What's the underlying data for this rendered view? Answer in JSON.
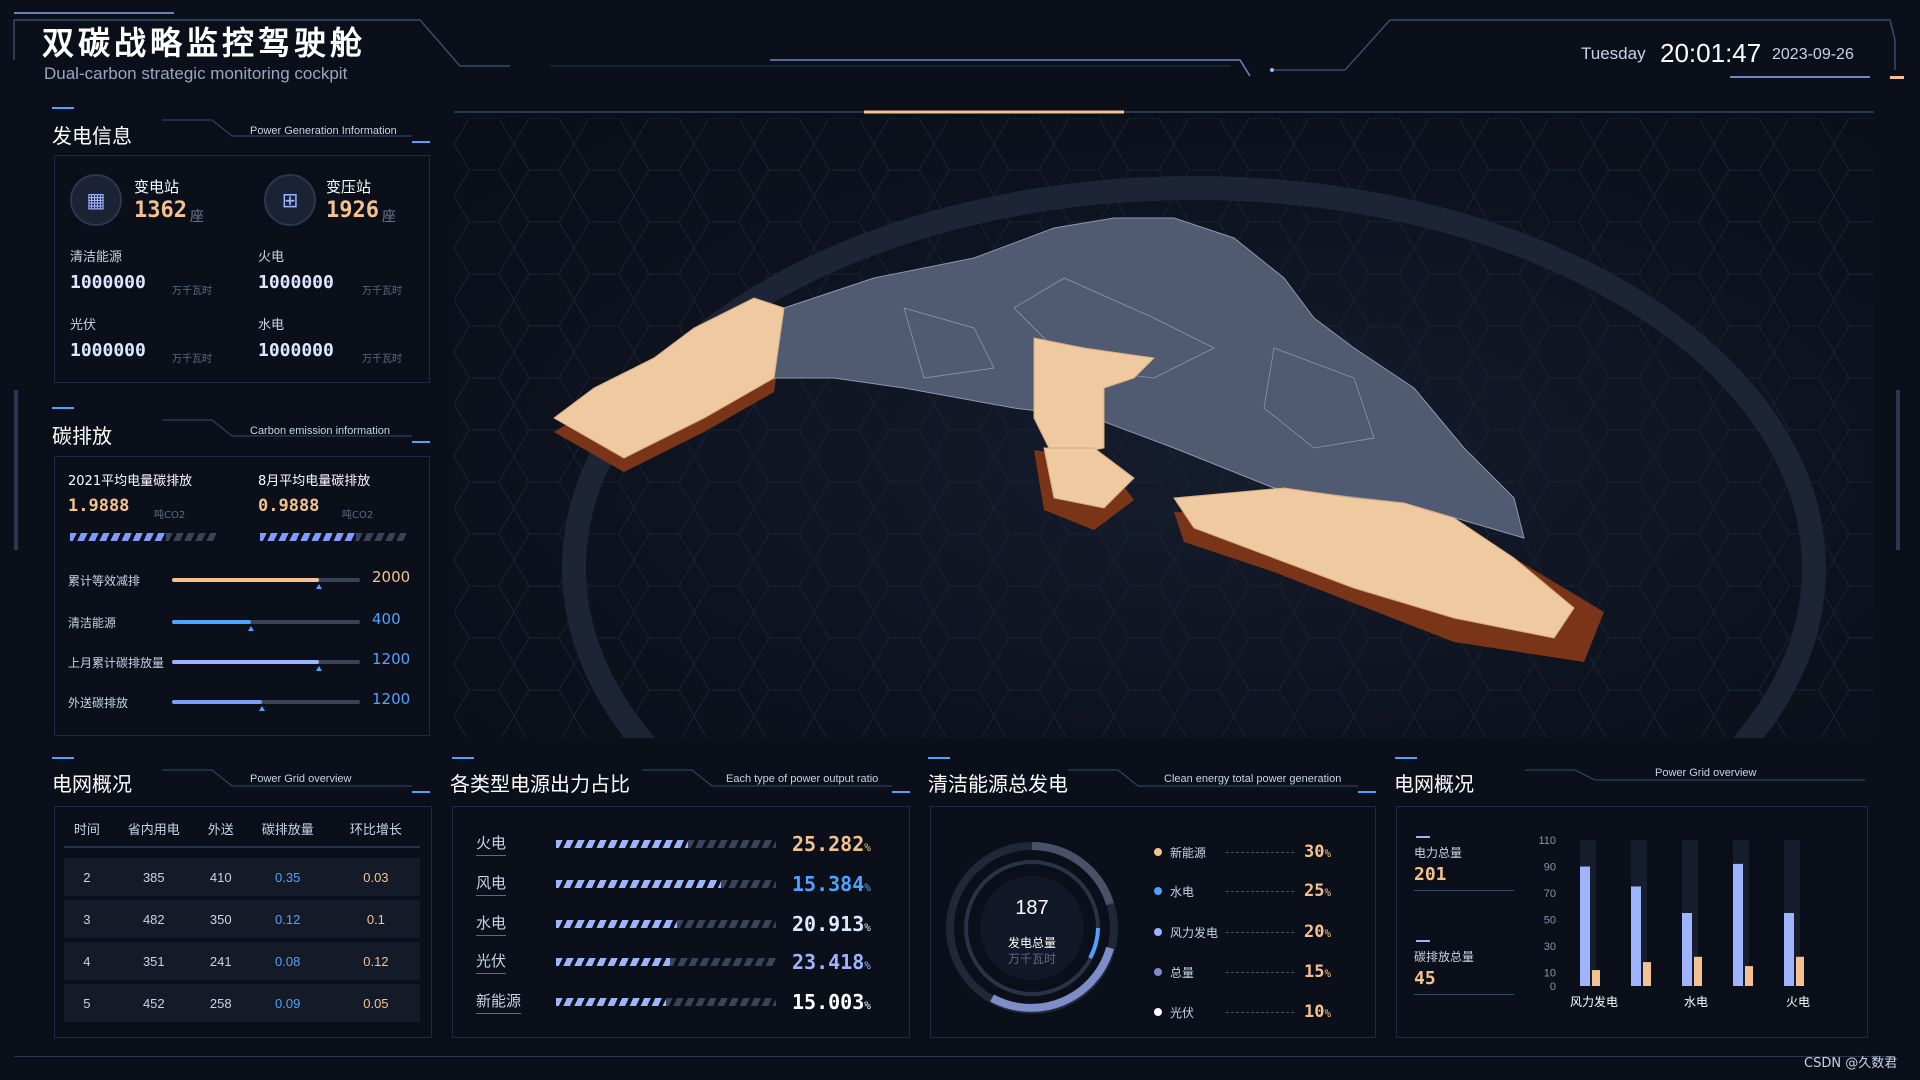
{
  "header": {
    "title": "双碳战略监控驾驶舱",
    "subtitle": "Dual-carbon strategic monitoring cockpit",
    "day": "Tuesday",
    "time": "20:01:47",
    "date": "2023-09-26"
  },
  "power_generation": {
    "title": "发电信息",
    "subtitle": "Power Generation Information",
    "substation": {
      "label": "变电站",
      "value": "1362",
      "unit": "座"
    },
    "transformer": {
      "label": "变压站",
      "value": "1926",
      "unit": "座"
    },
    "stats": [
      {
        "label": "清洁能源",
        "value": "1000000",
        "unit": "万千瓦时"
      },
      {
        "label": "火电",
        "value": "1000000",
        "unit": "万千瓦时"
      },
      {
        "label": "光伏",
        "value": "1000000",
        "unit": "万千瓦时"
      },
      {
        "label": "水电",
        "value": "1000000",
        "unit": "万千瓦时"
      }
    ]
  },
  "carbon": {
    "title": "碳排放",
    "subtitle": "Carbon emission information",
    "avg_2021": {
      "label": "2021平均电量碳排放",
      "value": "1.9888",
      "unit": "吨CO2"
    },
    "avg_aug": {
      "label": "8月平均电量碳排放",
      "value": "0.9888",
      "unit": "吨CO2"
    },
    "bars": [
      {
        "label": "累计等效减排",
        "value": "2000",
        "fraction": 0.78,
        "color": "#f3c28f"
      },
      {
        "label": "清洁能源",
        "value": "400",
        "fraction": 0.42,
        "color": "#4fa3ff"
      },
      {
        "label": "上月累计碳排放量",
        "value": "1200",
        "fraction": 0.78,
        "color": "#9fb4ff"
      },
      {
        "label": "外送碳排放",
        "value": "1200",
        "fraction": 0.48,
        "color": "#7e9cff"
      }
    ]
  },
  "grid_table": {
    "title": "电网概况",
    "subtitle": "Power Grid overview",
    "headers": [
      "时间",
      "省内用电",
      "外送",
      "碳排放量",
      "环比增长"
    ],
    "rows": [
      [
        "2",
        "385",
        "410",
        "0.35",
        "0.03"
      ],
      [
        "3",
        "482",
        "350",
        "0.12",
        "0.1"
      ],
      [
        "4",
        "351",
        "241",
        "0.08",
        "0.12"
      ],
      [
        "5",
        "452",
        "258",
        "0.09",
        "0.05"
      ]
    ]
  },
  "output_ratio": {
    "title": "各类型电源出力占比",
    "subtitle": "Each type of power output ratio",
    "items": [
      {
        "label": "火电",
        "value": "25.282",
        "fraction": 0.6,
        "color": "#f3c28f"
      },
      {
        "label": "风电",
        "value": "15.384",
        "fraction": 0.75,
        "color": "#4fa3ff"
      },
      {
        "label": "水电",
        "value": "20.913",
        "fraction": 0.55,
        "color": "#dfe6ff"
      },
      {
        "label": "光伏",
        "value": "23.418",
        "fraction": 0.52,
        "color": "#9fb4ff"
      },
      {
        "label": "新能源",
        "value": "15.003",
        "fraction": 0.5,
        "color": "#ffffff"
      }
    ],
    "percent": "%"
  },
  "clean_energy": {
    "title": "清洁能源总发电",
    "subtitle": "Clean energy total power generation",
    "total": "187",
    "total_label": "发电总量",
    "total_unit": "万千瓦时",
    "items": [
      {
        "label": "新能源",
        "value": "30",
        "color": "#f3c28f"
      },
      {
        "label": "水电",
        "value": "25",
        "color": "#4fa3ff"
      },
      {
        "label": "风力发电",
        "value": "20",
        "color": "#9fb4ff"
      },
      {
        "label": "总量",
        "value": "15",
        "color": "#7e8cc8"
      },
      {
        "label": "光伏",
        "value": "10",
        "color": "#ffffff"
      }
    ],
    "percent": "%"
  },
  "grid_overview": {
    "title": "电网概况",
    "subtitle": "Power Grid overview",
    "power_total": {
      "label": "电力总量",
      "value": "201"
    },
    "carbon_total": {
      "label": "碳排放总量",
      "value": "45"
    }
  },
  "chart_data": {
    "type": "bar",
    "categories": [
      "风力发电",
      "",
      "水电",
      "",
      "火电"
    ],
    "ylim": [
      0,
      110
    ],
    "yticks": [
      "110",
      "90",
      "70",
      "50",
      "30",
      "10",
      "0"
    ],
    "series": [
      {
        "values": [
          90,
          75,
          55,
          92,
          55
        ],
        "color": "#9fb4ff"
      },
      {
        "values": [
          12,
          18,
          22,
          15,
          22
        ],
        "color": "#f3c28f"
      }
    ]
  },
  "watermark": "CSDN @久数君"
}
